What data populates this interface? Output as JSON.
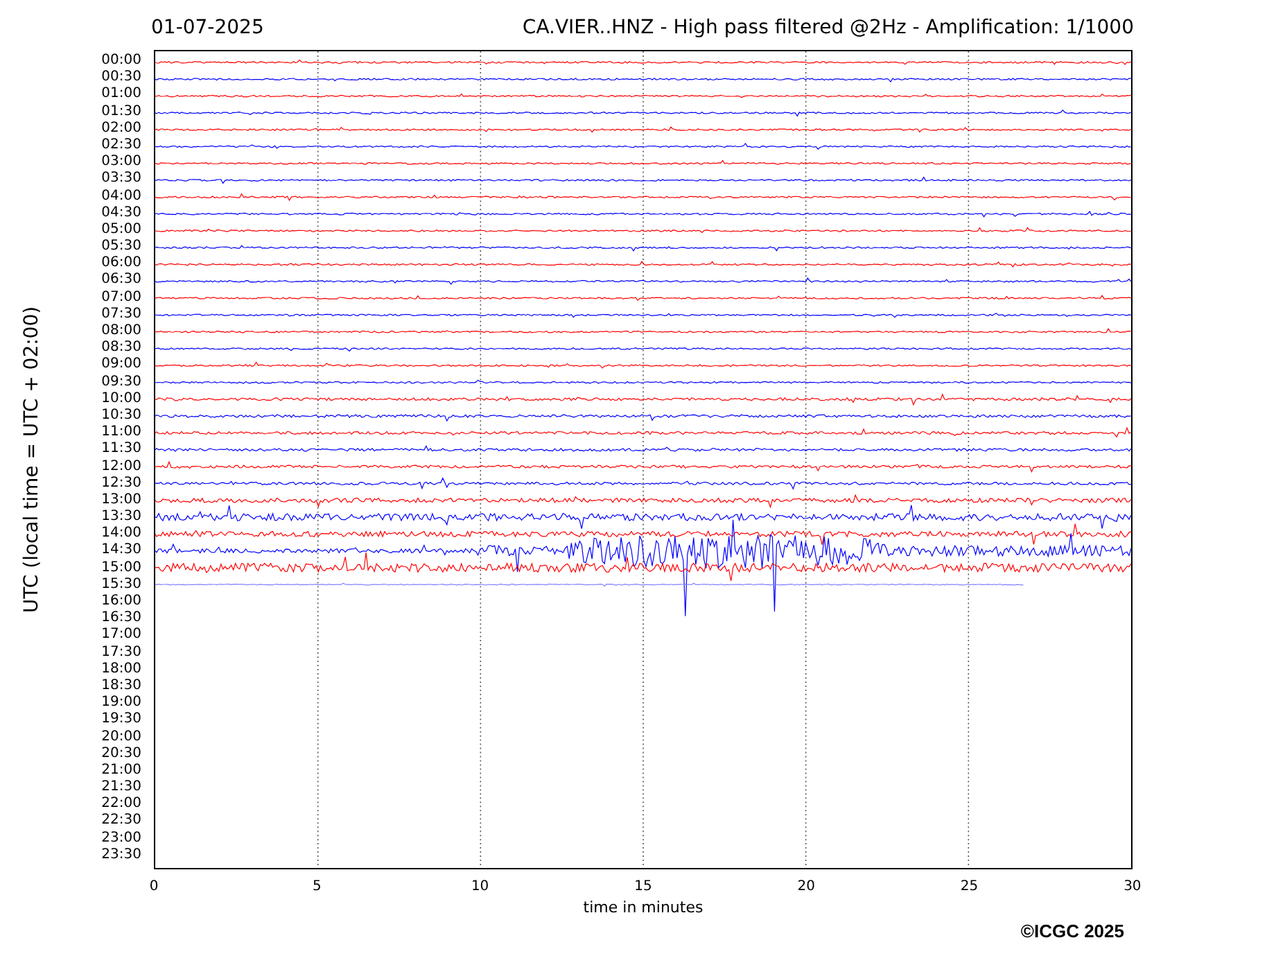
{
  "date": "01-07-2025",
  "title": "CA.VIER..HNZ - High pass filtered @2Hz - Amplification: 1/1000",
  "ylabel": "UTC (local time = UTC + 02:00)",
  "xlabel": "time in minutes",
  "xticks": [
    "0",
    "5",
    "10",
    "15",
    "20",
    "25",
    "30"
  ],
  "copyright": "©ICGC 2025",
  "rows": [
    {
      "label": "00:00",
      "color": "#ff0000"
    },
    {
      "label": "00:30",
      "color": "#0000ff"
    },
    {
      "label": "01:00",
      "color": "#ff0000"
    },
    {
      "label": "01:30",
      "color": "#0000ff"
    },
    {
      "label": "02:00",
      "color": "#ff0000"
    },
    {
      "label": "02:30",
      "color": "#0000ff"
    },
    {
      "label": "03:00",
      "color": "#ff0000"
    },
    {
      "label": "03:30",
      "color": "#0000ff"
    },
    {
      "label": "04:00",
      "color": "#ff0000"
    },
    {
      "label": "04:30",
      "color": "#0000ff"
    },
    {
      "label": "05:00",
      "color": "#ff0000"
    },
    {
      "label": "05:30",
      "color": "#0000ff"
    },
    {
      "label": "06:00",
      "color": "#ff0000"
    },
    {
      "label": "06:30",
      "color": "#0000ff"
    },
    {
      "label": "07:00",
      "color": "#ff0000"
    },
    {
      "label": "07:30",
      "color": "#0000ff"
    },
    {
      "label": "08:00",
      "color": "#ff0000"
    },
    {
      "label": "08:30",
      "color": "#0000ff"
    },
    {
      "label": "09:00",
      "color": "#ff0000"
    },
    {
      "label": "09:30",
      "color": "#0000ff"
    },
    {
      "label": "10:00",
      "color": "#ff0000"
    },
    {
      "label": "10:30",
      "color": "#0000ff"
    },
    {
      "label": "11:00",
      "color": "#ff0000"
    },
    {
      "label": "11:30",
      "color": "#0000ff"
    },
    {
      "label": "12:00",
      "color": "#ff0000"
    },
    {
      "label": "12:30",
      "color": "#0000ff"
    },
    {
      "label": "13:00",
      "color": "#ff0000"
    },
    {
      "label": "13:30",
      "color": "#0000ff"
    },
    {
      "label": "14:00",
      "color": "#ff0000"
    },
    {
      "label": "14:30",
      "color": "#0000ff"
    },
    {
      "label": "15:00",
      "color": "#ff0000"
    },
    {
      "label": "15:30",
      "color": "#8080ff",
      "level": 0.89
    },
    {
      "label": "16:00"
    },
    {
      "label": "16:30"
    },
    {
      "label": "17:00"
    },
    {
      "label": "17:30"
    },
    {
      "label": "18:00"
    },
    {
      "label": "18:30"
    },
    {
      "label": "19:00"
    },
    {
      "label": "19:30"
    },
    {
      "label": "20:00"
    },
    {
      "label": "20:30"
    },
    {
      "label": "21:00"
    },
    {
      "label": "21:30"
    },
    {
      "label": "22:00"
    },
    {
      "label": "22:30"
    },
    {
      "label": "23:00"
    },
    {
      "label": "23:30"
    }
  ]
}
